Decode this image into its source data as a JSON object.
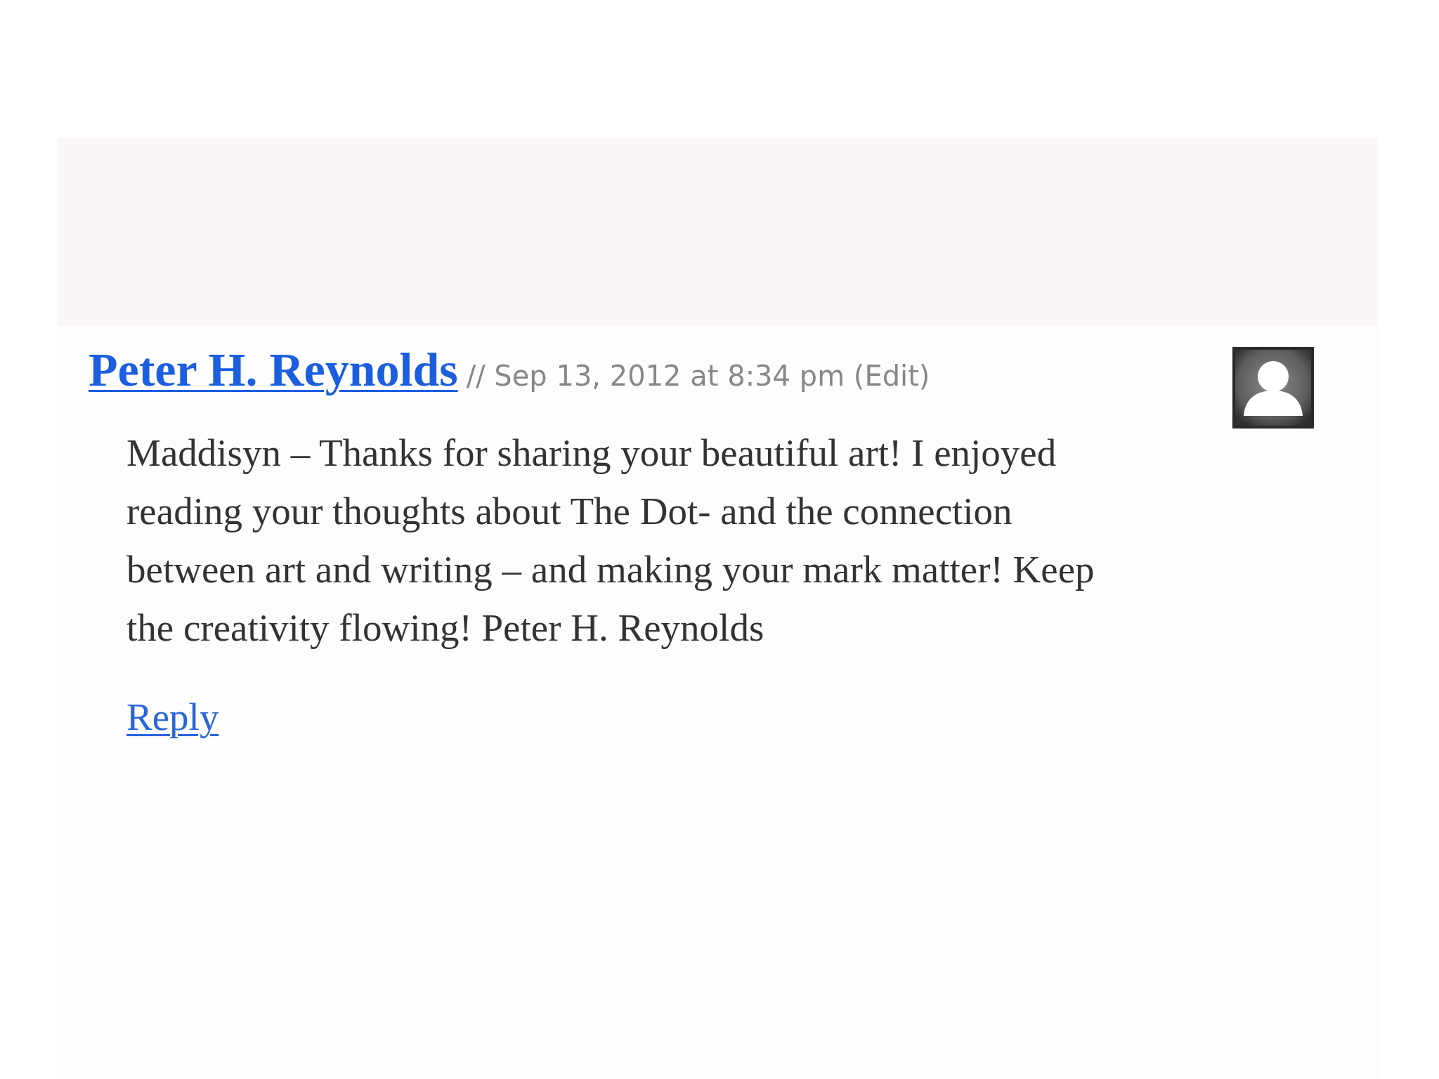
{
  "comment": {
    "author": "Peter H. Reynolds",
    "meta": "// Sep 13, 2012 at 8:34 pm (Edit)",
    "body": "Maddisyn – Thanks for sharing your beautiful art! I enjoyed reading your thoughts about The Dot- and the connection between art and writing – and making your mark matter! Keep the creativity flowing! Peter H. Reynolds",
    "reply": "Reply"
  }
}
